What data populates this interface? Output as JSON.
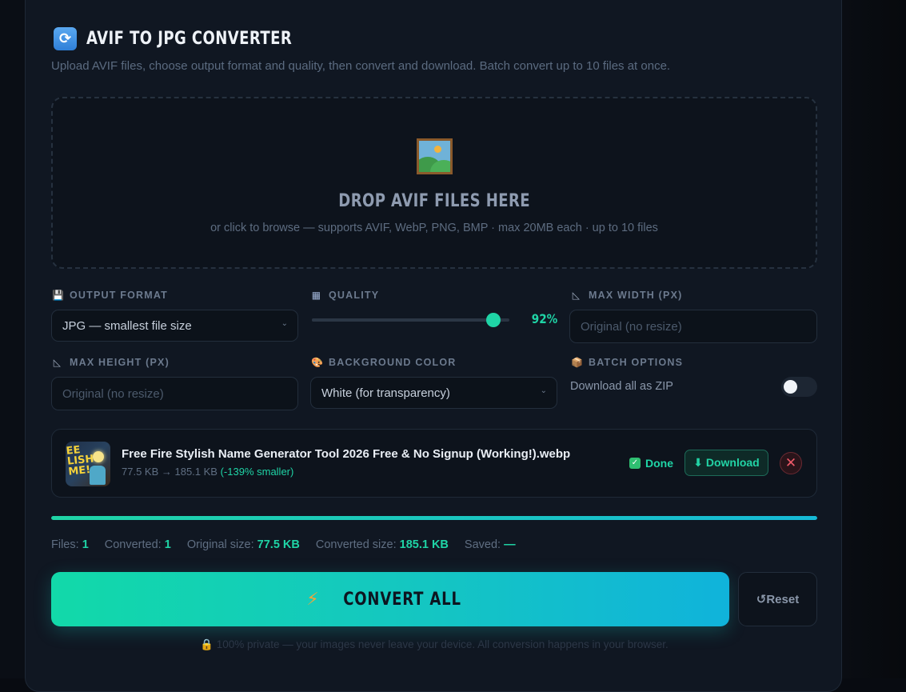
{
  "header": {
    "icon": "refresh-icon",
    "title": "AVIF TO JPG CONVERTER",
    "subtitle": "Upload AVIF files, choose output format and quality, then convert and download. Batch convert up to 10 files at once."
  },
  "dropzone": {
    "icon": "framed-picture-icon",
    "title": "DROP AVIF FILES HERE",
    "subtitle": "or click to browse — supports AVIF, WebP, PNG, BMP · max 20MB each · up to 10 files"
  },
  "options": {
    "output_format": {
      "label": "OUTPUT FORMAT",
      "icon": "floppy-disk-icon",
      "value": "JPG — smallest file size"
    },
    "quality": {
      "label": "QUALITY",
      "icon": "grid-icon",
      "value": 92,
      "display": "92%"
    },
    "max_width": {
      "label": "MAX WIDTH (PX)",
      "icon": "ruler-icon",
      "placeholder": "Original (no resize)"
    },
    "max_height": {
      "label": "MAX HEIGHT (PX)",
      "icon": "ruler-icon",
      "placeholder": "Original (no resize)"
    },
    "background_color": {
      "label": "BACKGROUND COLOR",
      "icon": "palette-icon",
      "value": "White (for transparency)"
    },
    "batch": {
      "label": "BATCH OPTIONS",
      "icon": "package-icon",
      "zip_label": "Download all as ZIP",
      "zip_enabled": false
    }
  },
  "files": [
    {
      "name": "Free Fire Stylish Name Generator Tool 2026 Free & No Signup (Working!).webp",
      "thumb_text": "EE LISH ME!",
      "size_info": "77.5 KB → 185.1 KB",
      "change": "(-139% smaller)",
      "status": "Done",
      "download_label": "⬇ Download",
      "remove_icon": "close-icon"
    }
  ],
  "progress": {
    "value": 1.0
  },
  "stats": {
    "files_label": "Files:",
    "files": "1",
    "converted_label": "Converted:",
    "converted": "1",
    "original_label": "Original size:",
    "original": "77.5 KB",
    "converted_size_label": "Converted size:",
    "converted_size": "185.1 KB",
    "saved_label": "Saved:",
    "saved": "—"
  },
  "actions": {
    "convert_label": "CONVERT ALL",
    "convert_icon": "lightning-icon",
    "reset_label": "↺Reset"
  },
  "footer": {
    "privacy": "100% private — your images never leave your device. All conversion happens in your browser."
  },
  "colors": {
    "accent": "#1fd4a6",
    "accent2": "#10b3db",
    "danger": "#f05a6a"
  }
}
